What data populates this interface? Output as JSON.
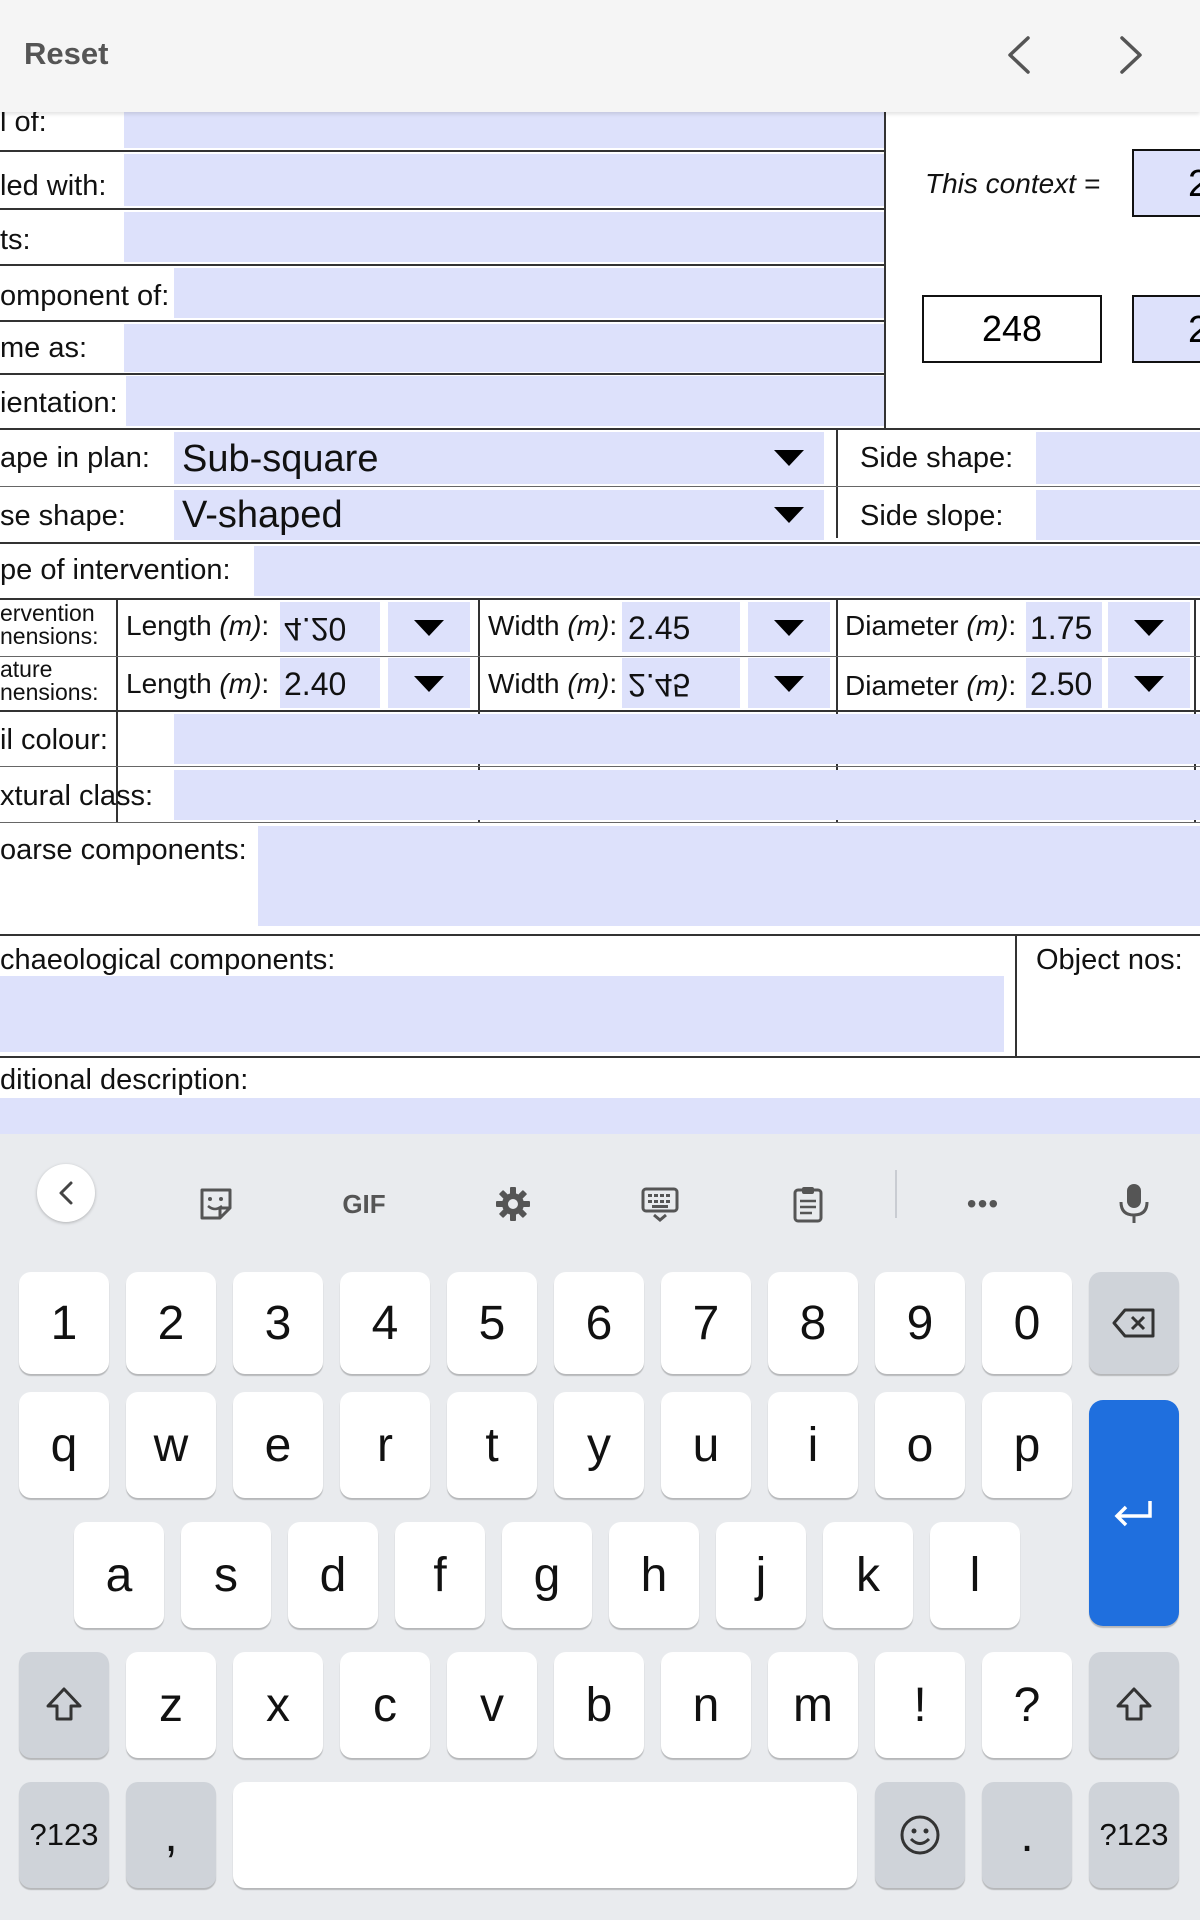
{
  "topbar": {
    "reset_label": "Reset",
    "prev_icon": "chevron-left-icon",
    "next_icon": "chevron-right-icon"
  },
  "form": {
    "labels": {
      "fill_of": "l of:",
      "filled_with": "led with:",
      "cuts": "ts:",
      "component_of": "omponent of:",
      "same_as": "me as:",
      "orientation": "ientation:",
      "shape_in_plan": "ape in plan:",
      "base_shape": "se shape:",
      "side_shape": "Side shape:",
      "side_slope": "Side slope:",
      "type_of_intervention": "pe of intervention:",
      "intervention_dims_1": "ervention",
      "intervention_dims_2": "nensions:",
      "feature_dims_1": "ature",
      "feature_dims_2": "nensions:",
      "soil_colour": "il colour:",
      "textural_class": "xtural class:",
      "coarse_components": "oarse components:",
      "archaeological_components": "chaeological components:",
      "object_nos": "Object nos:",
      "additional_description": "ditional description:",
      "this_context": "This context =",
      "length": "Length",
      "width": "Width",
      "diameter": "Diameter",
      "unit_m": "(m)",
      "colon": ":"
    },
    "values": {
      "shape_in_plan": "Sub-square",
      "base_shape": "V-shaped",
      "context_number": "248",
      "this_context_partial": "2",
      "box_partial": "2",
      "intervention_length": "4.20",
      "intervention_width": "2.45",
      "intervention_diameter": "1.75",
      "feature_length": "2.40",
      "feature_width": "2.45",
      "feature_diameter": "2.50"
    }
  },
  "keyboard": {
    "toolbar": {
      "back_icon": "chevron-left-icon",
      "sticker_icon": "sticker-icon",
      "gif_label": "GIF",
      "settings_icon": "gear-icon",
      "keyboard_icon": "keyboard-icon",
      "clipboard_icon": "clipboard-icon",
      "more_label": "•••",
      "mic_icon": "microphone-icon"
    },
    "number_row": [
      "1",
      "2",
      "3",
      "4",
      "5",
      "6",
      "7",
      "8",
      "9",
      "0"
    ],
    "row_q": [
      "q",
      "w",
      "e",
      "r",
      "t",
      "y",
      "u",
      "i",
      "o",
      "p"
    ],
    "row_a": [
      "a",
      "s",
      "d",
      "f",
      "g",
      "h",
      "j",
      "k",
      "l"
    ],
    "row_z": [
      "z",
      "x",
      "c",
      "v",
      "b",
      "n",
      "m",
      "!",
      "?"
    ],
    "bottom": {
      "symbols_left": "?123",
      "comma": ",",
      "period": ".",
      "symbols_right": "?123"
    },
    "icons": {
      "backspace": "backspace-icon",
      "enter": "enter-icon",
      "shift": "shift-icon",
      "emoji": "emoji-icon"
    }
  }
}
